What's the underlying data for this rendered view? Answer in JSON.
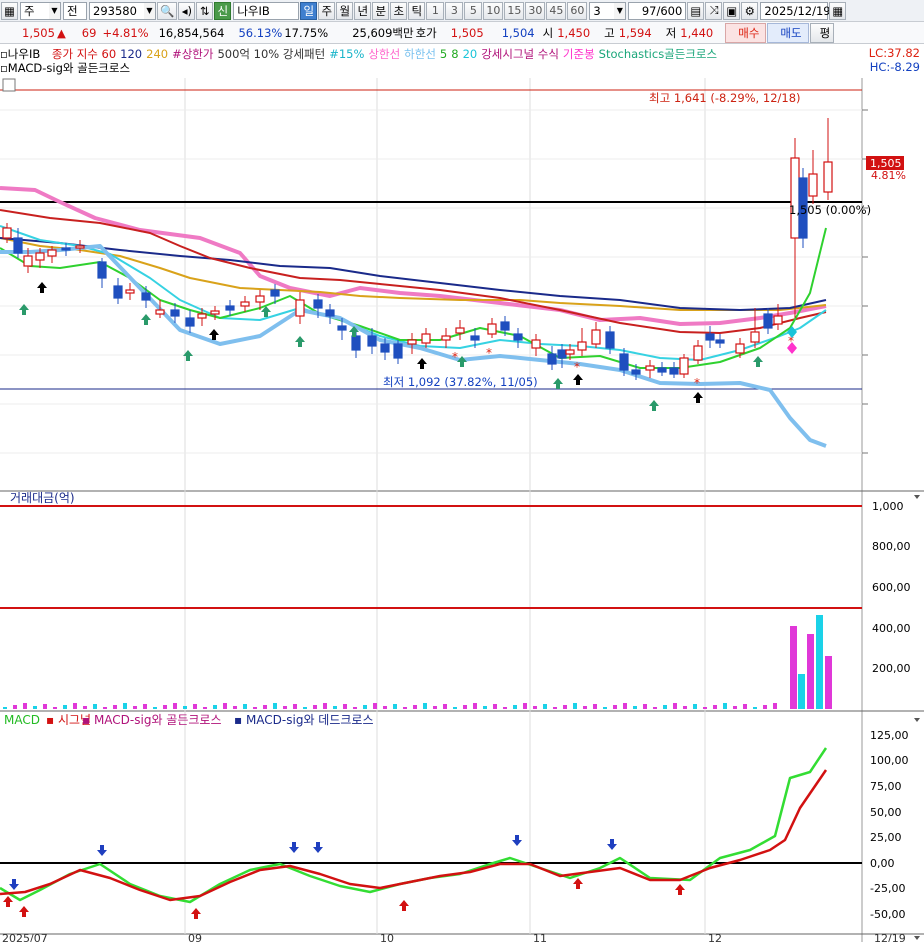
{
  "toolbar": {
    "type_label": "주",
    "market_label": "전",
    "code": "293580",
    "badge": "신",
    "name": "나우IB",
    "periods": [
      "일",
      "주",
      "월",
      "년",
      "분",
      "초",
      "틱"
    ],
    "active_period": "일",
    "minutes": [
      "1",
      "3",
      "5",
      "10",
      "15",
      "30",
      "45",
      "60"
    ],
    "count_value": "3",
    "paging": "97/600",
    "date": "2025/12/19",
    "buy_label": "매수",
    "sell_label": "매도",
    "eval_label": "평"
  },
  "quote": {
    "price": "1,505",
    "change": "69",
    "rate": "+4.81%",
    "volume": "16,854,564",
    "ratio1": "56.13%",
    "ratio2": "17.75%",
    "amount": "25,609백만",
    "hoga_label": "호가",
    "ask": "1,505",
    "bid": "1,504",
    "open_label": "시",
    "open": "1,450",
    "high_label": "고",
    "high": "1,594",
    "low_label": "저",
    "low": "1,440"
  },
  "legend": {
    "stock": "나우IB",
    "items": [
      {
        "text": "종가 지수 60",
        "color": "#d21111"
      },
      {
        "text": "120",
        "color": "#1a2a8a"
      },
      {
        "text": "240",
        "color": "#d9a21a"
      },
      {
        "text": "#상한가",
        "color": "#b0127a"
      },
      {
        "text": "500억 10% 강세패턴",
        "color": "#333333"
      },
      {
        "text": "#15%",
        "color": "#19b4c9"
      },
      {
        "text": "상한선",
        "color": "#ff66cc"
      },
      {
        "text": "하한선",
        "color": "#79c1ef"
      },
      {
        "text": "5",
        "color": "#22aa22"
      },
      {
        "text": "8",
        "color": "#22aa22"
      },
      {
        "text": "20",
        "color": "#19c4d9"
      },
      {
        "text": "강세시그널 수식",
        "color": "#b0127a"
      },
      {
        "text": "기준봉",
        "color": "#ff33cc"
      },
      {
        "text": "Stochastics골든크로스",
        "color": "#1aa67a"
      }
    ],
    "second_line": "MACD-sig와 골든크로스",
    "lc": "LC:37.82",
    "hc": "HC:-8.29"
  },
  "price_panel": {
    "high_note": "최고 1,641 (-8.29%, 12/18)",
    "low_note": "최저 1,092 (37.82%, 11/05)",
    "mid_note": "1,505 (0.00%)",
    "last_price": "1,505",
    "last_rate": "4.81%"
  },
  "volume_panel": {
    "title": "거래대금(억)",
    "axis": [
      "1,000",
      "800,00",
      "600,00",
      "400,00",
      "200,00"
    ]
  },
  "macd_panel": {
    "legend": [
      "MACD",
      "시그널",
      "MACD-sig와 골든크로스",
      "MACD-sig와 데드크로스"
    ],
    "axis": [
      "125,00",
      "100,00",
      "75,00",
      "50,00",
      "25,00",
      "0,00",
      "-25,00",
      "-50,00"
    ]
  },
  "x_axis": [
    "2025/07",
    "09",
    "10",
    "11",
    "12",
    "12/19"
  ],
  "colors": {
    "up": "#d21111",
    "down": "#1f4fbf",
    "ma60": "#c8201f",
    "ma120": "#1a2a8a",
    "ma240": "#d9a21a",
    "upper_band": "#ef7ac4",
    "lower_band": "#7fbfee",
    "ma5": "#2fd12f",
    "ma20": "#36d2e2",
    "volume_cyan": "#1ad2e8",
    "volume_magenta": "#e038d8"
  }
}
